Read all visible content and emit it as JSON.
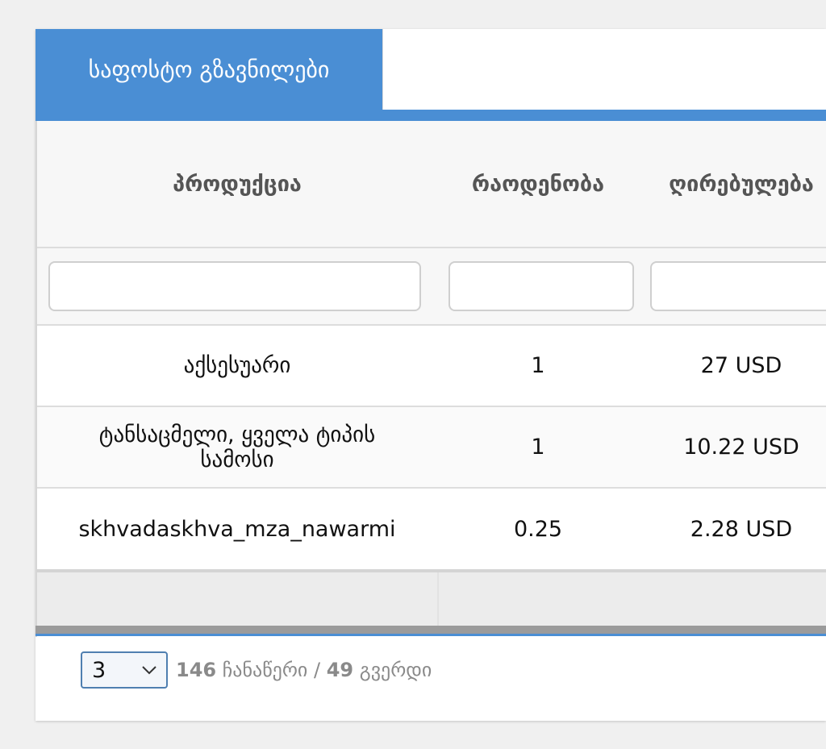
{
  "tabs": [
    {
      "label": "საფოსტო გზავნილები",
      "active": true
    }
  ],
  "table": {
    "columns": [
      "პროდუქცია",
      "რაოდენობა",
      "ღირებულება"
    ],
    "filters": [
      "",
      "",
      ""
    ],
    "rows": [
      {
        "product": "აქსესუარი",
        "quantity": "1",
        "value": "27 USD"
      },
      {
        "product": "ტანსაცმელი, ყველა ტიპის სამოსი",
        "quantity": "1",
        "value": "10.22 USD"
      },
      {
        "product": "skhvadaskhva_mza_nawarmi",
        "quantity": "0.25",
        "value": "2.28 USD"
      }
    ]
  },
  "pager": {
    "page_size": "3",
    "records_count": "146",
    "records_label": "ჩანაწერი",
    "separator": "/",
    "pages_count": "49",
    "pages_label": "გვერდი"
  },
  "colors": {
    "accent": "#4a8ed4",
    "select_border": "#4f7fb0"
  }
}
